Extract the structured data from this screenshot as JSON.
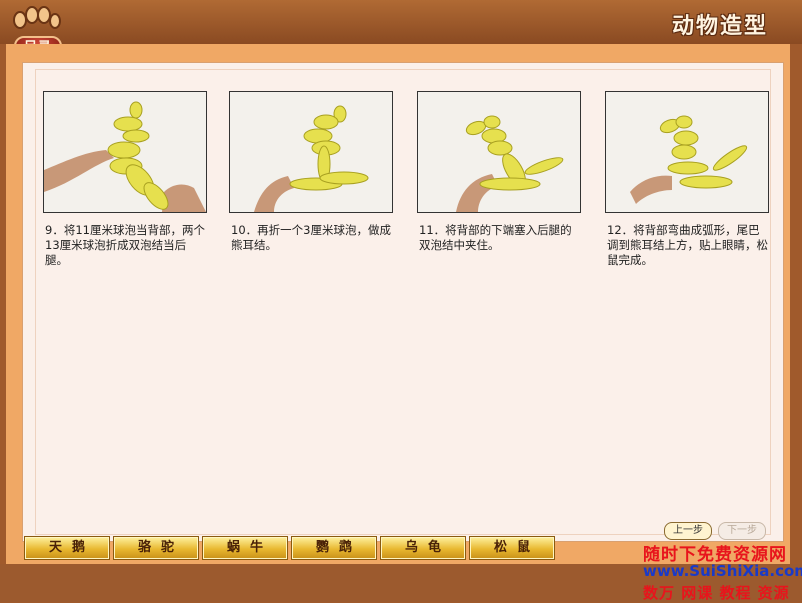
{
  "header": {
    "menu_label": "目录",
    "app_title": "动物造型"
  },
  "steps": [
    {
      "caption": "9．将11厘米球泡当背部，两个13厘米球泡折成双泡结当后腿。"
    },
    {
      "caption": "10．再折一个3厘米球泡，做成熊耳结。"
    },
    {
      "caption": "11．将背部的下端塞入后腿的双泡结中夹住。"
    },
    {
      "caption": "12．将背部弯曲成弧形，尾巴调到熊耳结上方，贴上眼睛，松鼠完成。"
    }
  ],
  "nav": {
    "prev_label": "上一步",
    "next_label": "下一步"
  },
  "tabs": [
    {
      "label": "天鹅"
    },
    {
      "label": "骆驼"
    },
    {
      "label": "蜗牛"
    },
    {
      "label": "鹦鹉"
    },
    {
      "label": "乌龟"
    },
    {
      "label": "松鼠"
    }
  ],
  "watermark": {
    "line1": "随时下免费资源网",
    "line2": "www.SuiShiXia.com",
    "line3": "数万 网课 教程 资源"
  },
  "colors": {
    "frame": "#f0a865",
    "panel": "#fbf0ea",
    "tab": "#e8b830",
    "balloon": "#e4e050"
  }
}
